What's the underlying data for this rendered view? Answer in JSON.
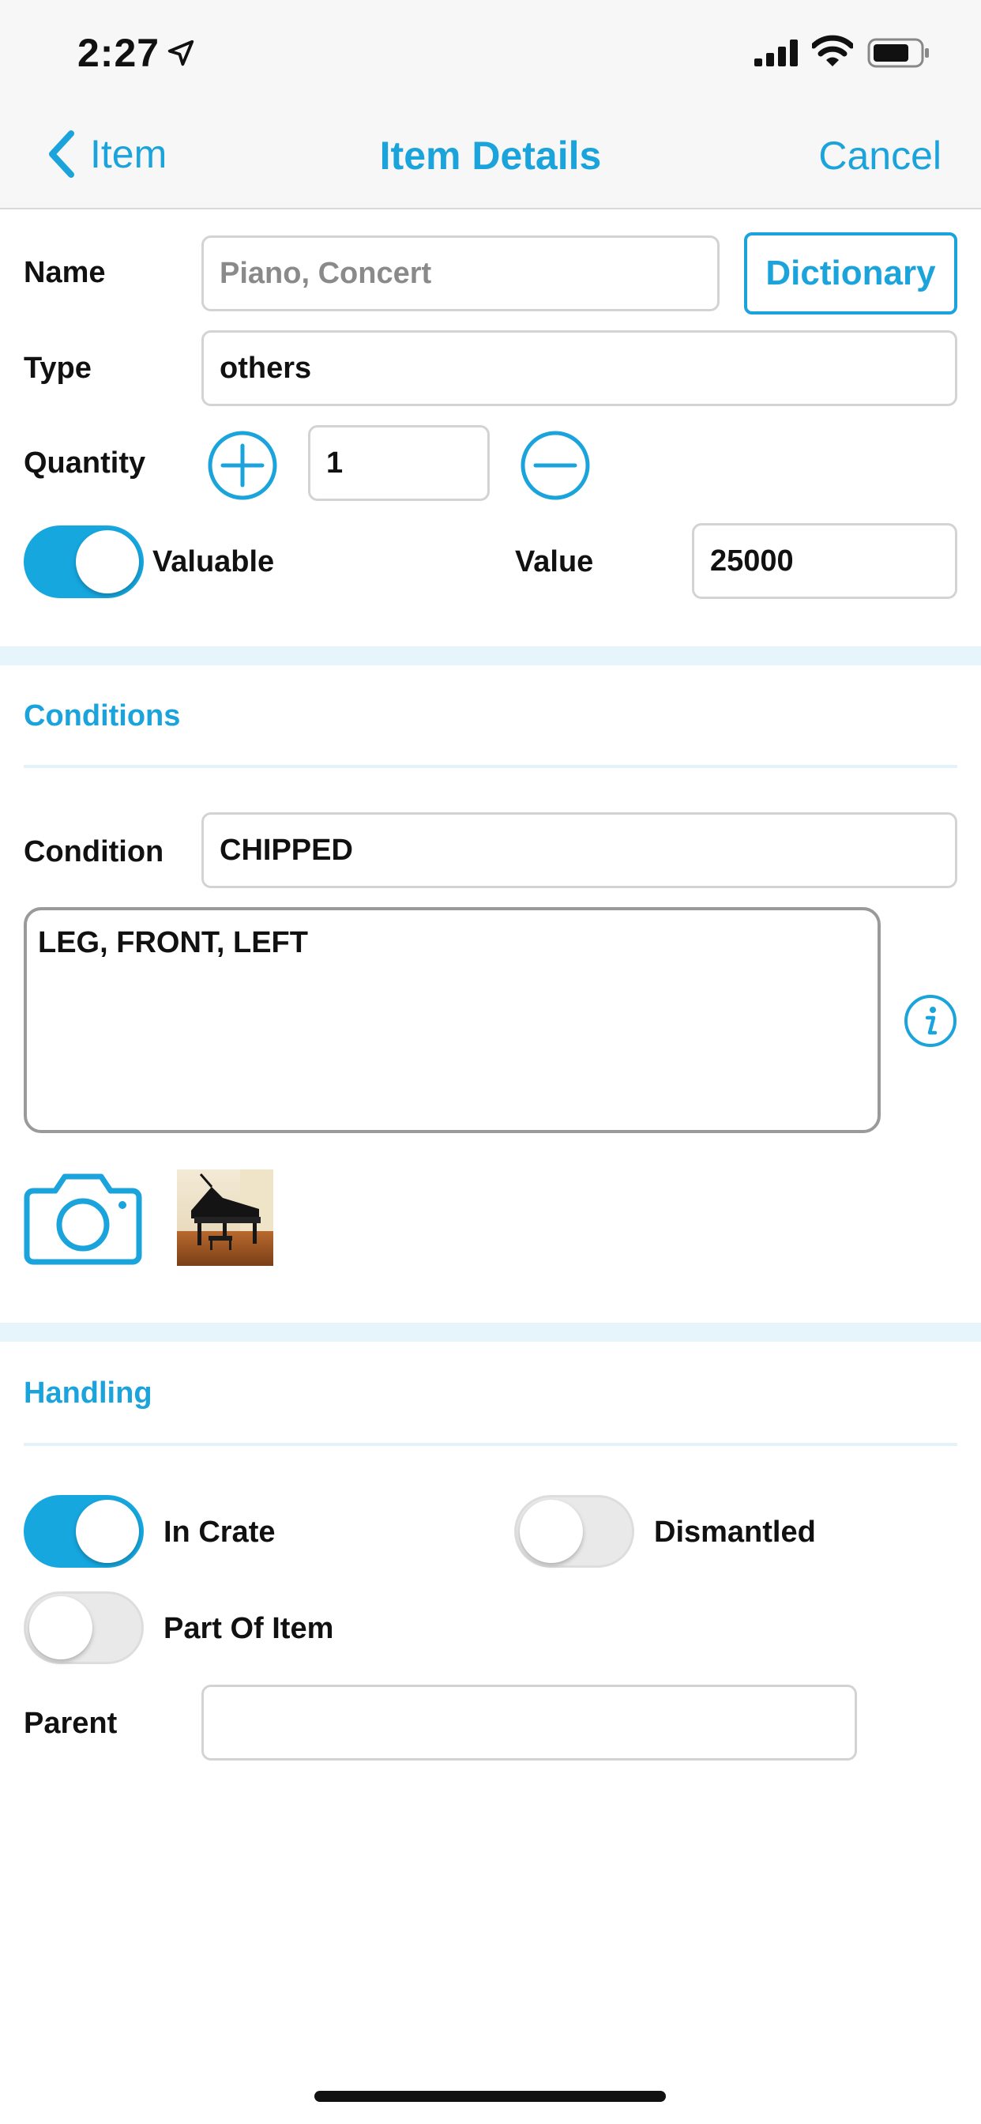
{
  "status_bar": {
    "time": "2:27",
    "icons": [
      "location-arrow-icon",
      "cellular-signal-icon",
      "wifi-icon",
      "battery-icon"
    ]
  },
  "nav": {
    "back_label": "Item",
    "title": "Item Details",
    "cancel_label": "Cancel"
  },
  "form": {
    "name_label": "Name",
    "name_placeholder": "Piano, Concert",
    "dictionary_label": "Dictionary",
    "type_label": "Type",
    "type_value": "others",
    "quantity_label": "Quantity",
    "quantity_value": "1",
    "valuable_label": "Valuable",
    "valuable_on": true,
    "value_label": "Value",
    "value_value": "25000"
  },
  "conditions": {
    "section_title": "Conditions",
    "condition_label": "Condition",
    "condition_value": "CHIPPED",
    "notes": "LEG, FRONT, LEFT",
    "photo_thumbnail": "grand-piano-photo"
  },
  "handling": {
    "section_title": "Handling",
    "in_crate_label": "In Crate",
    "in_crate_on": true,
    "dismantled_label": "Dismantled",
    "dismantled_on": false,
    "part_of_item_label": "Part Of Item",
    "part_of_item_on": false,
    "parent_label": "Parent",
    "parent_value": ""
  },
  "colors": {
    "accent": "#1ba3dc",
    "toggle_on": "#16a7df",
    "section_band": "#e6f5fb"
  }
}
